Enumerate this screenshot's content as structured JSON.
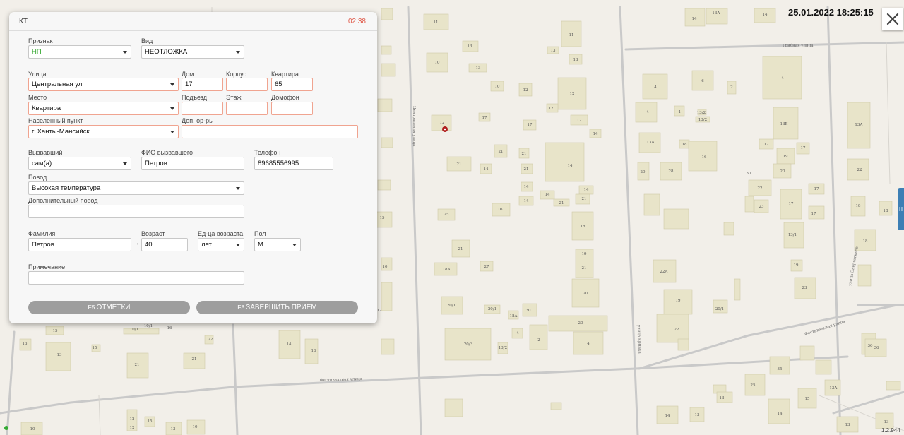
{
  "header": {
    "datetime": "25.01.2022 18:25:15"
  },
  "version": "1.2.944",
  "map": {
    "streets": [
      "Грибная улица",
      "Центральная улица",
      "Фестивальная улица",
      "улица Ермака",
      "Фестивальная улица",
      "Фестивальная улица",
      "улица Энергетиков"
    ],
    "house_numbers": [
      "11",
      "11",
      "10",
      "13",
      "13",
      "13",
      "13",
      "10",
      "12",
      "12",
      "12",
      "17",
      "17",
      "12",
      "12",
      "14",
      "21",
      "21",
      "21",
      "14",
      "21",
      "14",
      "14",
      "14",
      "14",
      "14",
      "21",
      "21",
      "16",
      "25",
      "18",
      "21",
      "19",
      "21",
      "18A",
      "27",
      "20",
      "20/1",
      "20/1",
      "18A",
      "30",
      "20",
      "20/3",
      "13/2",
      "2",
      "4",
      "4",
      "4",
      "6",
      "2",
      "4",
      "4",
      "4",
      "13/2",
      "13/2",
      "13Б",
      "13А",
      "13А",
      "18",
      "16",
      "17",
      "17",
      "19",
      "20",
      "28",
      "20",
      "30",
      "22",
      "22",
      "17",
      "17",
      "23",
      "17",
      "18",
      "18",
      "13/1",
      "18",
      "22А",
      "19",
      "23",
      "19",
      "20/1",
      "22",
      "36",
      "36",
      "35",
      "25",
      "13",
      "15",
      "13А",
      "14",
      "14",
      "13",
      "13",
      "13",
      "14",
      "13А",
      "14",
      "15",
      "10",
      "12",
      "15",
      "13",
      "10/1",
      "10/1",
      "16",
      "21",
      "21",
      "22",
      "14",
      "16"
    ]
  },
  "form": {
    "title": "КТ",
    "timer": "02:38",
    "priznak": {
      "label": "Признак",
      "value": "НП"
    },
    "vid": {
      "label": "Вид",
      "value": "НЕОТЛОЖКА"
    },
    "ulitsa": {
      "label": "Улица",
      "value": "Центральная ул"
    },
    "dom": {
      "label": "Дом",
      "value": "17"
    },
    "korpus": {
      "label": "Корпус",
      "value": ""
    },
    "kvartira": {
      "label": "Квартира",
      "value": "65"
    },
    "mesto": {
      "label": "Место",
      "value": "Квартира"
    },
    "podezd": {
      "label": "Подъезд",
      "value": ""
    },
    "etazh": {
      "label": "Этаж",
      "value": ""
    },
    "domofon": {
      "label": "Домофон",
      "value": ""
    },
    "naselenny_punkt": {
      "label": "Населенный пункт",
      "value": "г. Ханты-Мансийск"
    },
    "dop_orry": {
      "label": "Доп. ор-ры",
      "value": ""
    },
    "vyzvavshiy": {
      "label": "Вызвавший",
      "value": "сам(а)"
    },
    "fio_vyzvavshego": {
      "label": "ФИО вызвавшего",
      "value": "Петров"
    },
    "telefon": {
      "label": "Телефон",
      "value": "89685556995"
    },
    "povod": {
      "label": "Повод",
      "value": "Высокая температура"
    },
    "dop_povod": {
      "label": "Дополнительный повод",
      "value": ""
    },
    "familiya": {
      "label": "Фамилия",
      "value": "Петров"
    },
    "vozrast": {
      "label": "Возраст",
      "value": "40"
    },
    "ed_vozrasta": {
      "label": "Ед-ца возраста",
      "value": "лет"
    },
    "pol": {
      "label": "Пол",
      "value": "М"
    },
    "primechanie": {
      "label": "Примечание",
      "value": ""
    },
    "btn_otmetki": {
      "key": "F5",
      "label": "ОТМЕТКИ"
    },
    "btn_zavershit": {
      "key": "F8",
      "label": "ЗАВЕРШИТЬ ПРИЕМ"
    }
  },
  "colors": {
    "accent_red": "#e05a4a",
    "required_border": "#f0a490",
    "green_text": "#3aaa35",
    "button_gray": "#9e9e9e",
    "map_bg": "#f2efe9",
    "building": "#e8e4c9",
    "side_tab": "#3d7fb5"
  }
}
